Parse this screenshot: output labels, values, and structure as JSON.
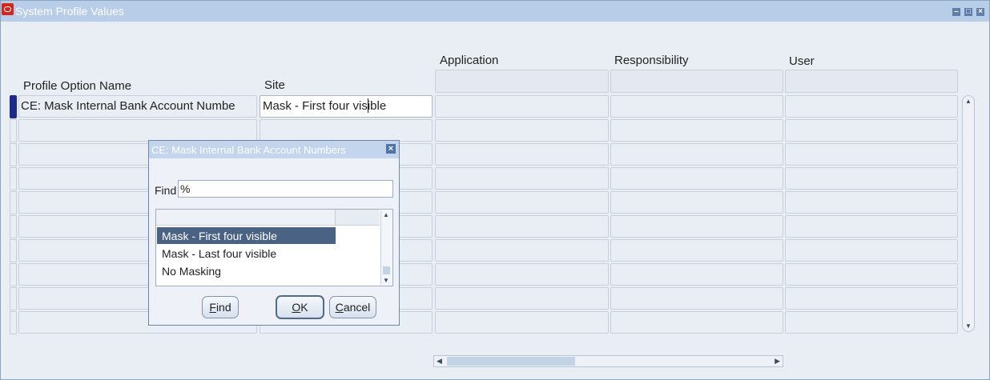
{
  "window": {
    "title": "System Profile Values"
  },
  "columns": {
    "profile_option_name": "Profile Option Name",
    "site": "Site",
    "application": "Application",
    "responsibility": "Responsibility",
    "user": "User"
  },
  "rows": [
    {
      "profile_option_name": "CE: Mask Internal Bank Account Numbe",
      "site": "Mask - First four visible"
    }
  ],
  "dialog": {
    "title": "CE: Mask Internal Bank Account Numbers",
    "find_label": "Find",
    "find_value": "%",
    "options": [
      "Mask - First four visible",
      "Mask - Last four visible",
      "No Masking"
    ],
    "selected_option": "Mask - First four visible",
    "buttons": {
      "find": {
        "label": "Find",
        "mnemonic": "F",
        "rest": "ind"
      },
      "ok": {
        "label": "OK",
        "mnemonic": "O",
        "rest": "K"
      },
      "cancel": {
        "label": "Cancel",
        "mnemonic": "C",
        "rest": "ancel"
      }
    }
  },
  "icons": {
    "app": "oracle-icon",
    "minimize": "minimize-icon",
    "maximize": "maximize-icon",
    "close": "close-icon"
  },
  "colors": {
    "titlebar": "#b7cde8",
    "background": "#e9eef5",
    "row_indicator_active": "#1d2a8c",
    "selected_option": "#4a6283"
  }
}
